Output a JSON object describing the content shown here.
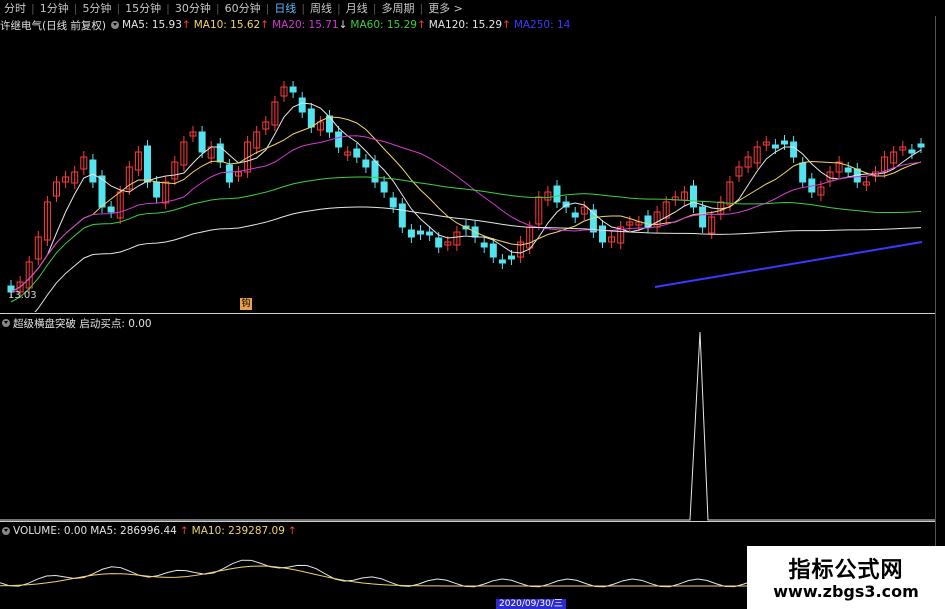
{
  "toolbar": {
    "tabs": [
      "分时",
      "1分钟",
      "5分钟",
      "15分钟",
      "30分钟",
      "60分钟",
      "日线",
      "周线",
      "月线",
      "多周期",
      "更多 >"
    ],
    "active_tab": "日线"
  },
  "main_panel": {
    "stock": "许继电气(日线 前复权)",
    "ma": [
      {
        "label": "MA5: 15.93",
        "color": "#e6e6e6",
        "dir": "up"
      },
      {
        "label": "MA10: 15.62",
        "color": "#f2d36b",
        "dir": "up"
      },
      {
        "label": "MA20: 15.71",
        "color": "#d23ad2",
        "dir": "down"
      },
      {
        "label": "MA60: 15.29",
        "color": "#3fcf3f",
        "dir": "up"
      },
      {
        "label": "MA120: 15.29",
        "color": "#e6e6e6",
        "dir": "up"
      },
      {
        "label": "MA250: 14",
        "color": "#3a3aff",
        "dir": ""
      }
    ],
    "low_price_label": "13.03",
    "marker": "钩"
  },
  "indicator_panel": {
    "title": "超级横盘突破 启动买点: 0.00"
  },
  "volume_panel": {
    "vol_label": "VOLUME: 0.00",
    "ma5_label": "MA5: 286996.44",
    "ma10_label": "MA10: 239287.09",
    "date_label": "2020/09/30/三"
  },
  "watermark": {
    "title": "指标公式网",
    "url": "www.zbgs3.com"
  },
  "colors": {
    "up_candle": "#ff3b3b",
    "down_candle": "#54e4f0",
    "ma5": "#e6e6e6",
    "ma10": "#f2d36b",
    "ma20": "#d23ad2",
    "ma60": "#3fcf3f",
    "ma120": "#e6e6e6",
    "ma250": "#3a3aff"
  }
}
